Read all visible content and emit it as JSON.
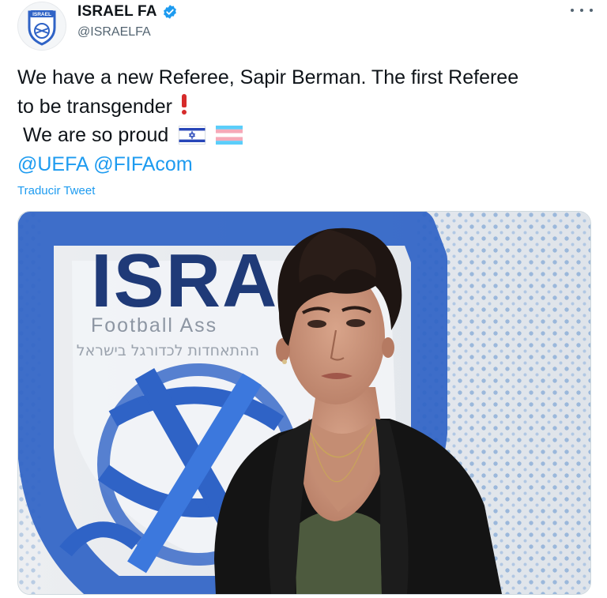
{
  "author": {
    "display_name": "ISRAEL FA",
    "handle": "@ISRAELFA",
    "verified": true,
    "avatar_text": "ISRAEL"
  },
  "tweet": {
    "line1": "We have a new Referee, Sapir Berman. The first Referee",
    "line2": "to be transgender",
    "line3": "We are so proud",
    "mention1": "@UEFA",
    "mention2": "@FIFAcom",
    "emojis": [
      "red-exclamation-icon",
      "israel-flag-icon",
      "transgender-flag-icon"
    ]
  },
  "translate_label": "Traducir Tweet",
  "media": {
    "logo_word": "ISRA",
    "logo_subtitle": "Football Ass",
    "logo_hebrew": "ההתאחדות לכדורגל בישראל"
  },
  "colors": {
    "link": "#1d9bf0",
    "verified": "#1d9bf0",
    "logo_blue": "#2f63c6",
    "logo_navy": "#1f3a78"
  }
}
